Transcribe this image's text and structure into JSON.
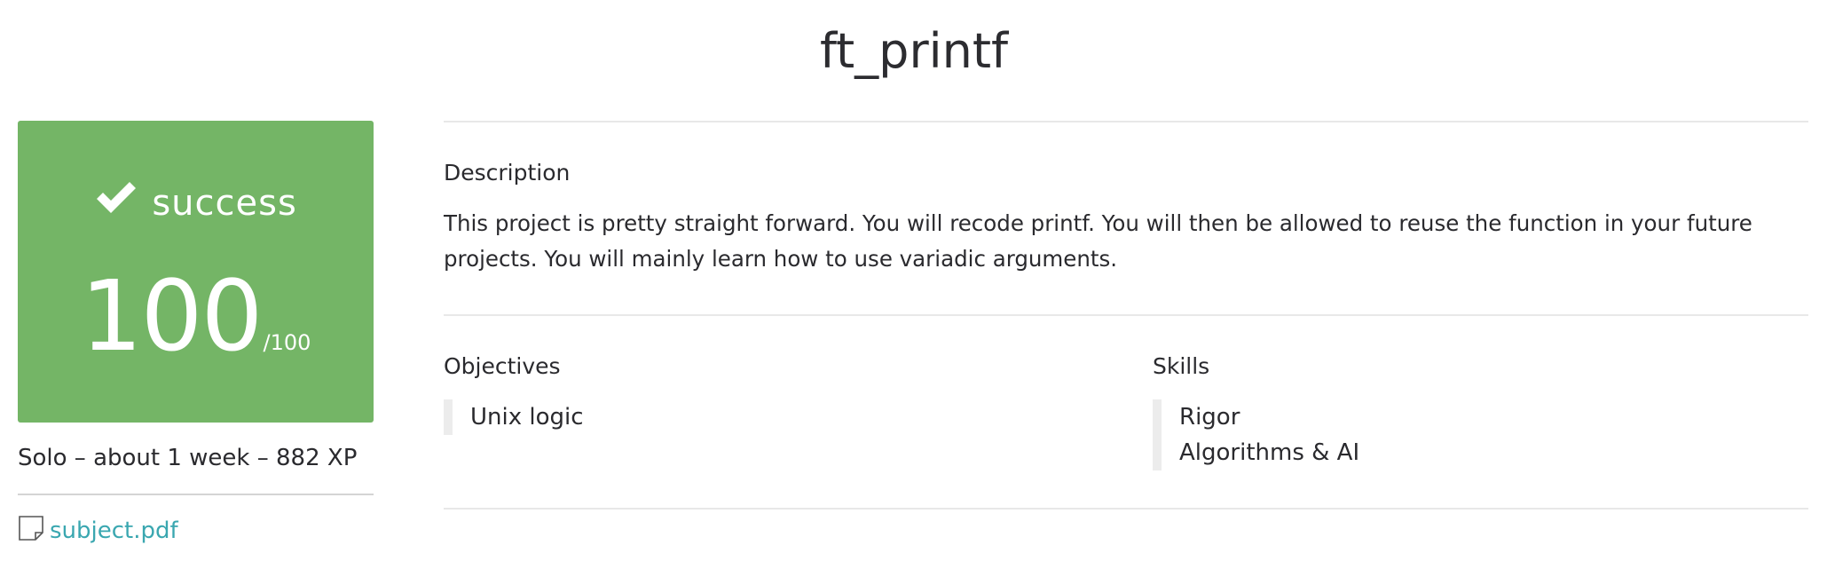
{
  "page": {
    "title": "ft_printf"
  },
  "grade": {
    "status": "success",
    "status_icon": "checkmark-icon",
    "score": "100",
    "max": "/100",
    "card_color": "#74b566"
  },
  "meta": {
    "line": "Solo – about 1 week – 882 XP"
  },
  "attachment": {
    "icon": "document-icon",
    "label": "subject.pdf",
    "link_color": "#3aa7b0"
  },
  "description": {
    "title": "Description",
    "text": "This project is pretty straight forward. You will recode printf. You will then be allowed to reuse the function in your future projects. You will mainly learn how to use variadic arguments."
  },
  "objectives": {
    "title": "Objectives",
    "items": [
      "Unix logic"
    ]
  },
  "skills": {
    "title": "Skills",
    "items": [
      "Rigor",
      "Algorithms & AI"
    ]
  }
}
